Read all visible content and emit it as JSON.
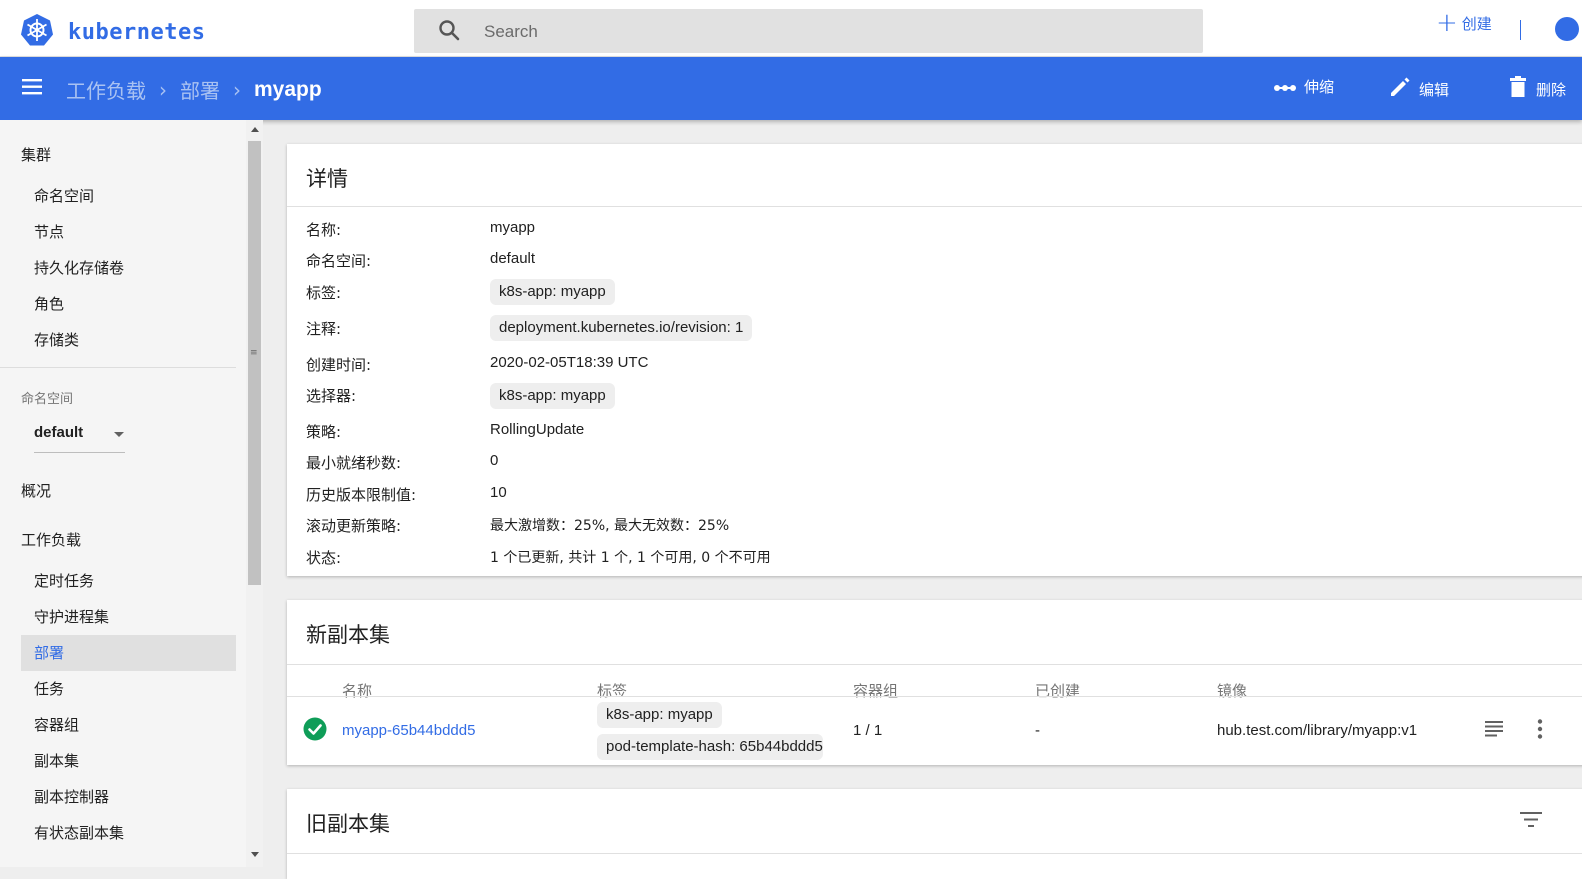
{
  "colors": {
    "brand": "#326ce5",
    "success": "#0f9d58"
  },
  "topbar": {
    "logo_text": "kubernetes",
    "search_placeholder": "Search",
    "create_label": "创建",
    "icons": [
      "kubernetes-logo-icon",
      "search-icon",
      "plus-icon",
      "account-icon"
    ]
  },
  "actionbar": {
    "breadcrumb": [
      "工作负载",
      "部署",
      "myapp"
    ],
    "actions": {
      "scale": "伸缩",
      "edit": "编辑",
      "delete": "删除"
    }
  },
  "sidebar": {
    "cluster_header": "集群",
    "cluster_items": [
      "命名空间",
      "节点",
      "持久化存储卷",
      "角色",
      "存储类"
    ],
    "namespace_label": "命名空间",
    "namespace_value": "default",
    "overview": "概况",
    "workloads_header": "工作负载",
    "workload_items": [
      "定时任务",
      "守护进程集",
      "部署",
      "任务",
      "容器组",
      "副本集",
      "副本控制器",
      "有状态副本集"
    ],
    "active_item": "部署"
  },
  "details": {
    "title": "详情",
    "rows": {
      "name": {
        "key": "名称:",
        "value": "myapp"
      },
      "namespace": {
        "key": "命名空间:",
        "value": "default"
      },
      "labels": {
        "key": "标签:",
        "value": "k8s-app: myapp"
      },
      "annotations": {
        "key": "注释:",
        "value": "deployment.kubernetes.io/revision:  1"
      },
      "created": {
        "key": "创建时间:",
        "value": "2020-02-05T18:39 UTC"
      },
      "selector": {
        "key": "选择器:",
        "value": "k8s-app: myapp"
      },
      "strategy": {
        "key": "策略:",
        "value": "RollingUpdate"
      },
      "min_ready": {
        "key": "最小就绪秒数:",
        "value": "0"
      },
      "history_limit": {
        "key": "历史版本限制值:",
        "value": "10"
      },
      "rolling_update": {
        "key": "滚动更新策略:",
        "value": "最大激增数：25%, 最大无效数：25%"
      },
      "status": {
        "key": "状态:",
        "value": "1 个已更新, 共计 1 个, 1 个可用, 0 个不可用"
      }
    }
  },
  "new_replica_set": {
    "title": "新副本集",
    "columns": [
      "名称",
      "标签",
      "容器组",
      "已创建",
      "镜像"
    ],
    "row": {
      "name": "myapp-65b44bddd5",
      "labels": [
        "k8s-app: myapp",
        "pod-template-hash: 65b44bddd5"
      ],
      "pods": "1 / 1",
      "created": "-",
      "image": "hub.test.com/library/myapp:v1"
    }
  },
  "old_replica_sets": {
    "title": "旧副本集"
  }
}
